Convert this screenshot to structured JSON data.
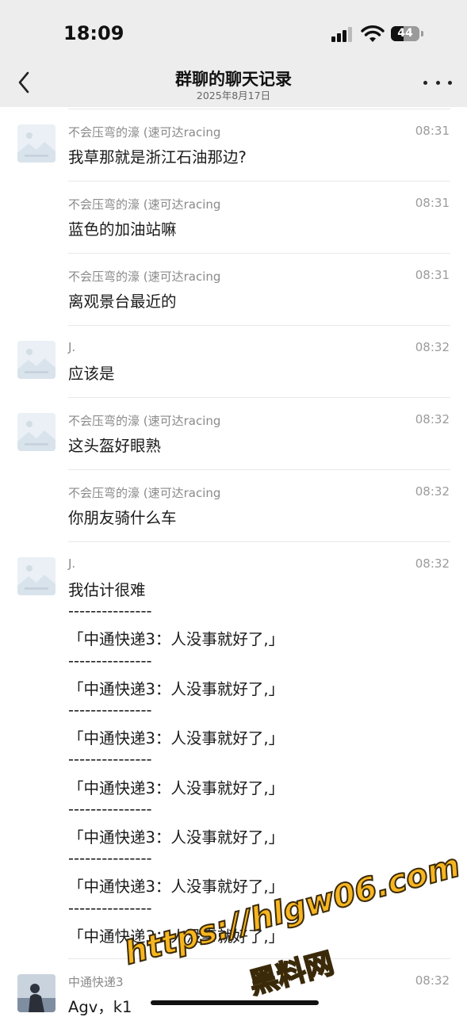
{
  "status_bar": {
    "time": "18:09",
    "battery": "44",
    "battery_level": 0.44
  },
  "nav": {
    "title": "群聊的聊天记录",
    "subtitle": "2025年8月17日"
  },
  "messages": [
    {
      "sender": "不会压弯的濠 (速可达racing",
      "time": "08:31",
      "lines": [
        "我草那就是浙江石油那边?"
      ],
      "avatar": "placeholder-image"
    },
    {
      "sender": "不会压弯的濠 (速可达racing",
      "time": "08:31",
      "lines": [
        "蓝色的加油站嘛"
      ],
      "avatar": ""
    },
    {
      "sender": "不会压弯的濠 (速可达racing",
      "time": "08:31",
      "lines": [
        "离观景台最近的"
      ],
      "avatar": ""
    },
    {
      "sender": "J.",
      "time": "08:32",
      "lines": [
        "应该是"
      ],
      "avatar": "placeholder-image"
    },
    {
      "sender": "不会压弯的濠 (速可达racing",
      "time": "08:32",
      "lines": [
        "这头盔好眼熟"
      ],
      "avatar": "placeholder-image"
    },
    {
      "sender": "不会压弯的濠 (速可达racing",
      "time": "08:32",
      "lines": [
        "你朋友骑什么车"
      ],
      "avatar": ""
    },
    {
      "sender": "J.",
      "time": "08:32",
      "avatar": "placeholder-image",
      "lines": [
        "我估计很难",
        "---------------",
        "「中通快递3：人没事就好了,」",
        "---------------",
        "「中通快递3：人没事就好了,」",
        "---------------",
        "「中通快递3：人没事就好了,」",
        "---------------",
        "「中通快递3：人没事就好了,」",
        "---------------",
        "「中通快递3：人没事就好了,」",
        "---------------",
        "「中通快递3：人没事就好了,」",
        "---------------",
        "「中通快递3：人没事就好了,」"
      ]
    },
    {
      "sender": "中通快递3",
      "time": "08:32",
      "lines": [
        "Agv，k1"
      ],
      "avatar": "photo"
    }
  ],
  "watermark": {
    "url": "https://hlgw06.com",
    "name": "黑料网"
  },
  "icons": [
    "signal-icon",
    "wifi-icon",
    "battery-icon",
    "back-icon",
    "more-icon",
    "placeholder-image-icon"
  ]
}
